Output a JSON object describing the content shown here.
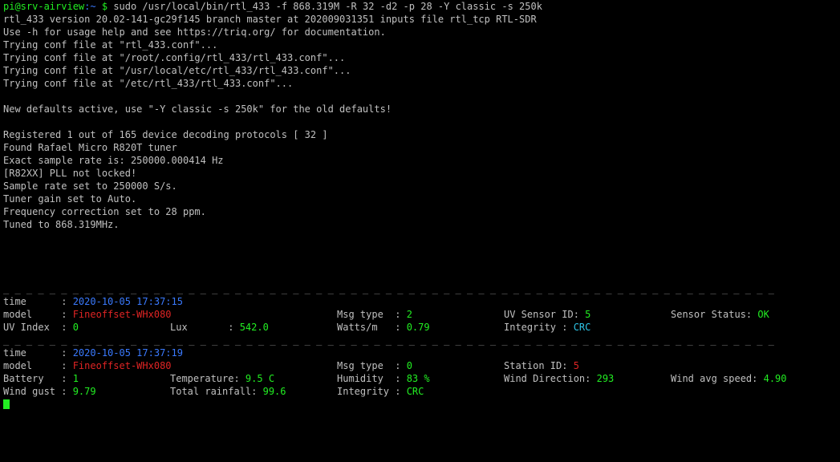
{
  "prompt": {
    "user_host": "pi@srv-airview",
    "path": ":~",
    "symbol": "$",
    "command": "sudo /usr/local/bin/rtl_433 -f 868.319M -R 32 -d2 -p 28 -Y classic -s 250k"
  },
  "log": {
    "l1": "rtl_433 version 20.02-141-gc29f145 branch master at 202009031351 inputs file rtl_tcp RTL-SDR",
    "l2": "Use -h for usage help and see https://triq.org/ for documentation.",
    "l3": "Trying conf file at \"rtl_433.conf\"...",
    "l4": "Trying conf file at \"/root/.config/rtl_433/rtl_433.conf\"...",
    "l5": "Trying conf file at \"/usr/local/etc/rtl_433/rtl_433.conf\"...",
    "l6": "Trying conf file at \"/etc/rtl_433/rtl_433.conf\"...",
    "l7": "New defaults active, use \"-Y classic -s 250k\" for the old defaults!",
    "l8": "Registered 1 out of 165 device decoding protocols [ 32 ]",
    "l9": "Found Rafael Micro R820T tuner",
    "l10": "Exact sample rate is: 250000.000414 Hz",
    "l11": "[R82XX] PLL not locked!",
    "l12": "Sample rate set to 250000 S/s.",
    "l13": "Tuner gain set to Auto.",
    "l14": "Frequency correction set to 28 ppm.",
    "l15": "Tuned to 868.319MHz."
  },
  "separator": "_ _ _ _ _ _ _ _ _ _ _ _ _ _ _ _ _ _ _ _ _ _ _ _ _ _ _ _ _ _ _ _ _ _ _ _ _ _ _ _ _ _ _ _ _ _ _ _ _ _ _ _ _ _ _ _ _ _ _ _ _ _ _ _ _ _ _",
  "msg1": {
    "time_label": "time      : ",
    "time": "2020-10-05 17:37:15",
    "model_label": "model     : ",
    "model": "Fineoffset-WHx080",
    "msgtype_label": "Msg type  : ",
    "msgtype": "2",
    "uvsensor_label": "UV Sensor ID: ",
    "uvsensor": "5",
    "status_label": "Sensor Status: ",
    "status": "OK",
    "uvindex_label": "UV Index  : ",
    "uvindex": "0",
    "lux_label": "Lux       : ",
    "lux": "542.0",
    "watts_label": "Watts/m   : ",
    "watts": "0.79",
    "integrity_label": "Integrity : ",
    "integrity": "CRC"
  },
  "msg2": {
    "time_label": "time      : ",
    "time": "2020-10-05 17:37:19",
    "model_label": "model     : ",
    "model": "Fineoffset-WHx080",
    "msgtype_label": "Msg type  : ",
    "msgtype": "0",
    "station_label": "Station ID: ",
    "station": "5",
    "battery_label": "Battery   : ",
    "battery": "1",
    "temp_label": "Temperature: ",
    "temp": "9.5 C",
    "humidity_label": "Humidity  : ",
    "humidity": "83 %",
    "winddir_label": "Wind Direction: ",
    "winddir": "293",
    "windavg_label": "Wind avg speed: ",
    "windavg": "4.90",
    "gust_label": "Wind gust : ",
    "gust": "9.79",
    "rain_label": "Total rainfall: ",
    "rain": "99.6",
    "integrity_label": "Integrity : ",
    "integrity": "CRC"
  },
  "colors": {
    "prompt": "#22ee22",
    "time": "#3a7aff",
    "model": "#e02424",
    "value": "#22ee22",
    "crc": "#2ec4e6"
  }
}
